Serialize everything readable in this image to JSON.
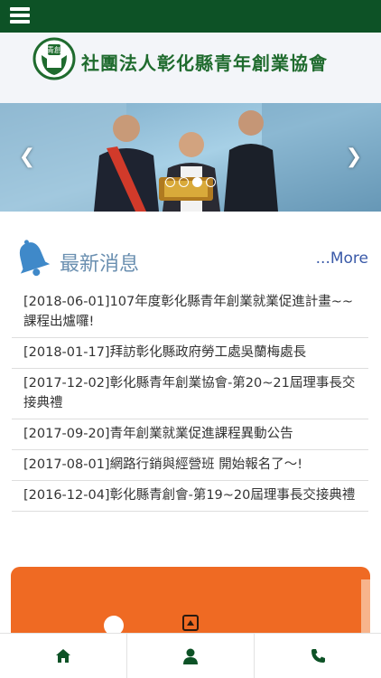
{
  "header": {
    "org_name": "社團法人彰化縣青年創業協會",
    "logo_text": "青創"
  },
  "banner": {
    "prev_icon": "chevron-left-icon",
    "next_icon": "chevron-right-icon",
    "dots": 4,
    "active_dot": 2
  },
  "news": {
    "title": "最新消息",
    "more_label": "...More",
    "items": [
      "[2018-06-01]107年度彰化縣青年創業就業促進計畫~~課程出爐囉!",
      "[2018-01-17]拜訪彰化縣政府勞工處吳蘭梅處長",
      "[2017-12-02]彰化縣青年創業協會-第20~21屆理事長交接典禮",
      "[2017-09-20]青年創業就業促進課程異動公告",
      "[2017-08-01]網路行銷與經營班 開始報名了～!",
      "[2016-12-04]彰化縣青創會-第19~20屆理事長交接典禮"
    ]
  },
  "bottom_nav": {
    "icons": [
      "home-icon",
      "user-icon",
      "phone-icon"
    ]
  },
  "colors": {
    "topbar": "#0d5226",
    "brand_green": "#1f6b2e",
    "news_title": "#6a8fb0",
    "more_link": "#3a5aa8",
    "card": "#ef6a23",
    "nav_icon": "#0d5226"
  }
}
